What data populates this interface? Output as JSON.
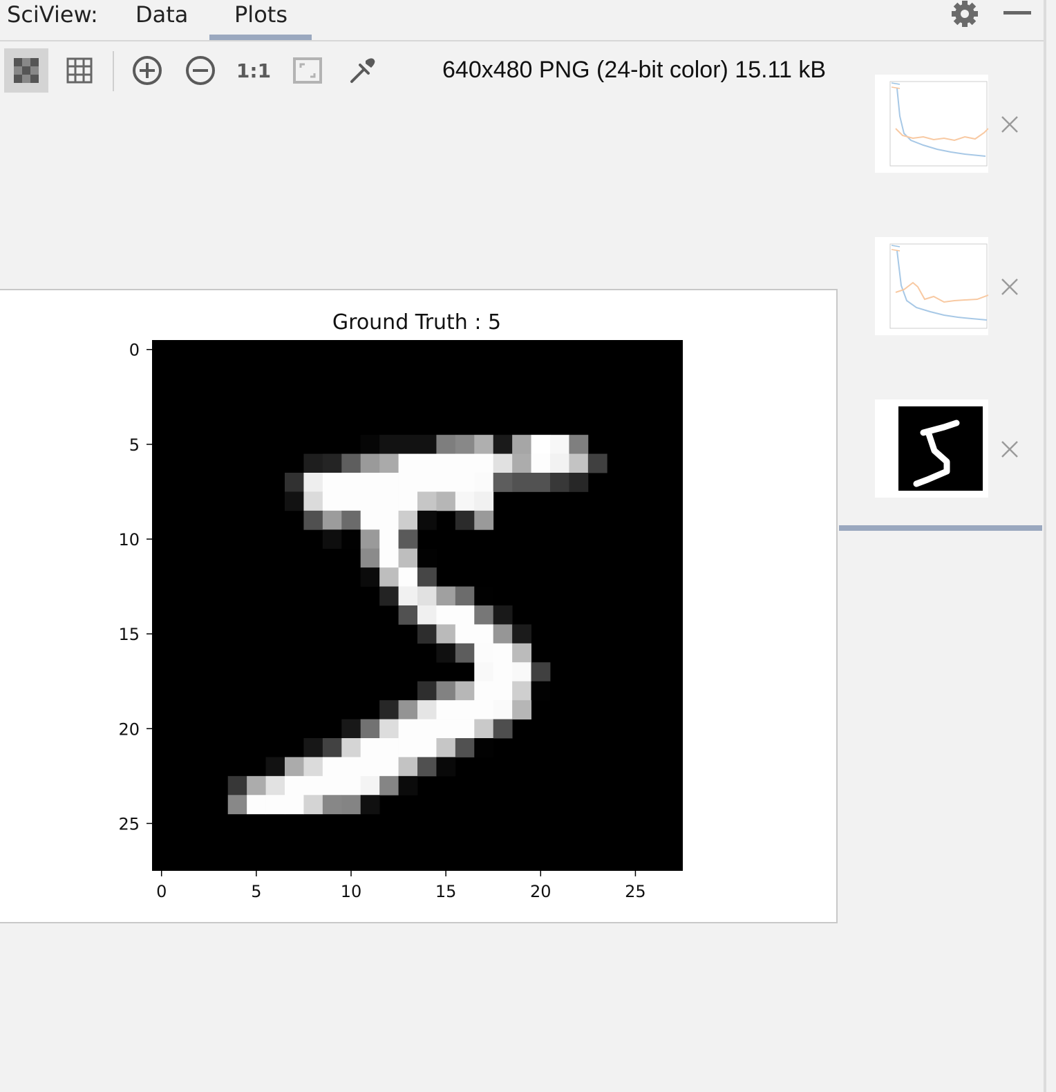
{
  "header": {
    "app_label": "SciView:",
    "tabs": [
      {
        "label": "Data",
        "active": false
      },
      {
        "label": "Plots",
        "active": true
      }
    ],
    "settings_icon": "gear-icon",
    "minimize_icon": "minimize-icon"
  },
  "toolbar": {
    "buttons": [
      {
        "name": "chessboard-toggle",
        "icon": "chessboard-icon",
        "active": true
      },
      {
        "name": "grid-toggle",
        "icon": "grid-icon",
        "active": false
      },
      {
        "name": "zoom-in",
        "icon": "zoom-in-icon",
        "active": false
      },
      {
        "name": "zoom-out",
        "icon": "zoom-out-icon",
        "active": false
      },
      {
        "name": "actual-size",
        "icon": "one-to-one-icon",
        "label": "1:1",
        "active": false
      },
      {
        "name": "fit-zoom",
        "icon": "fit-zoom-icon",
        "active": false
      },
      {
        "name": "color-picker",
        "icon": "eyedropper-icon",
        "active": false
      }
    ],
    "image_info": "640x480 PNG (24-bit color) 15.11 kB"
  },
  "plot": {
    "title": "Ground Truth : 5",
    "x_ticks": [
      "0",
      "5",
      "10",
      "15",
      "20",
      "25"
    ],
    "y_ticks": [
      "0",
      "5",
      "10",
      "15",
      "20",
      "25"
    ]
  },
  "chart_data": {
    "type": "heatmap",
    "title": "Ground Truth : 5",
    "xlim": [
      -0.5,
      27.5
    ],
    "ylim": [
      27.5,
      -0.5
    ],
    "colormap": "gray",
    "grid": false,
    "rows": 28,
    "cols": 28,
    "pixels": [
      [
        5,
        11,
        6
      ],
      [
        5,
        12,
        18
      ],
      [
        5,
        13,
        18
      ],
      [
        5,
        14,
        18
      ],
      [
        5,
        15,
        126
      ],
      [
        5,
        16,
        136
      ],
      [
        5,
        17,
        175
      ],
      [
        5,
        18,
        26
      ],
      [
        5,
        19,
        166
      ],
      [
        5,
        20,
        255
      ],
      [
        5,
        21,
        247
      ],
      [
        5,
        22,
        127
      ],
      [
        6,
        8,
        30
      ],
      [
        6,
        9,
        36
      ],
      [
        6,
        10,
        94
      ],
      [
        6,
        11,
        154
      ],
      [
        6,
        12,
        170
      ],
      [
        6,
        13,
        253
      ],
      [
        6,
        14,
        253
      ],
      [
        6,
        15,
        253
      ],
      [
        6,
        16,
        253
      ],
      [
        6,
        17,
        253
      ],
      [
        6,
        18,
        225
      ],
      [
        6,
        19,
        172
      ],
      [
        6,
        20,
        253
      ],
      [
        6,
        21,
        242
      ],
      [
        6,
        22,
        195
      ],
      [
        6,
        23,
        64
      ],
      [
        7,
        7,
        49
      ],
      [
        7,
        8,
        238
      ],
      [
        7,
        9,
        253
      ],
      [
        7,
        10,
        253
      ],
      [
        7,
        11,
        253
      ],
      [
        7,
        12,
        253
      ],
      [
        7,
        13,
        253
      ],
      [
        7,
        14,
        253
      ],
      [
        7,
        15,
        253
      ],
      [
        7,
        16,
        253
      ],
      [
        7,
        17,
        251
      ],
      [
        7,
        18,
        93
      ],
      [
        7,
        19,
        82
      ],
      [
        7,
        20,
        82
      ],
      [
        7,
        21,
        56
      ],
      [
        7,
        22,
        39
      ],
      [
        8,
        7,
        18
      ],
      [
        8,
        8,
        219
      ],
      [
        8,
        9,
        253
      ],
      [
        8,
        10,
        253
      ],
      [
        8,
        11,
        253
      ],
      [
        8,
        12,
        253
      ],
      [
        8,
        13,
        253
      ],
      [
        8,
        14,
        198
      ],
      [
        8,
        15,
        182
      ],
      [
        8,
        16,
        247
      ],
      [
        8,
        17,
        241
      ],
      [
        9,
        8,
        80
      ],
      [
        9,
        9,
        156
      ],
      [
        9,
        10,
        107
      ],
      [
        9,
        11,
        253
      ],
      [
        9,
        12,
        253
      ],
      [
        9,
        13,
        205
      ],
      [
        9,
        14,
        11
      ],
      [
        9,
        16,
        43
      ],
      [
        9,
        17,
        154
      ],
      [
        10,
        9,
        14
      ],
      [
        10,
        10,
        1
      ],
      [
        10,
        11,
        154
      ],
      [
        10,
        12,
        253
      ],
      [
        10,
        13,
        90
      ],
      [
        11,
        11,
        139
      ],
      [
        11,
        12,
        253
      ],
      [
        11,
        13,
        190
      ],
      [
        11,
        14,
        2
      ],
      [
        12,
        11,
        11
      ],
      [
        12,
        12,
        190
      ],
      [
        12,
        13,
        253
      ],
      [
        12,
        14,
        70
      ],
      [
        13,
        12,
        35
      ],
      [
        13,
        13,
        241
      ],
      [
        13,
        14,
        225
      ],
      [
        13,
        15,
        160
      ],
      [
        13,
        16,
        108
      ],
      [
        13,
        17,
        1
      ],
      [
        14,
        13,
        81
      ],
      [
        14,
        14,
        240
      ],
      [
        14,
        15,
        253
      ],
      [
        14,
        16,
        253
      ],
      [
        14,
        17,
        119
      ],
      [
        14,
        18,
        25
      ],
      [
        15,
        14,
        45
      ],
      [
        15,
        15,
        186
      ],
      [
        15,
        16,
        253
      ],
      [
        15,
        17,
        253
      ],
      [
        15,
        18,
        150
      ],
      [
        15,
        19,
        27
      ],
      [
        16,
        15,
        16
      ],
      [
        16,
        16,
        93
      ],
      [
        16,
        17,
        252
      ],
      [
        16,
        18,
        253
      ],
      [
        16,
        19,
        187
      ],
      [
        17,
        17,
        249
      ],
      [
        17,
        18,
        253
      ],
      [
        17,
        19,
        249
      ],
      [
        17,
        20,
        64
      ],
      [
        18,
        14,
        46
      ],
      [
        18,
        15,
        130
      ],
      [
        18,
        16,
        183
      ],
      [
        18,
        17,
        253
      ],
      [
        18,
        18,
        253
      ],
      [
        18,
        19,
        207
      ],
      [
        18,
        20,
        2
      ],
      [
        19,
        12,
        39
      ],
      [
        19,
        13,
        148
      ],
      [
        19,
        14,
        229
      ],
      [
        19,
        15,
        253
      ],
      [
        19,
        16,
        253
      ],
      [
        19,
        17,
        253
      ],
      [
        19,
        18,
        250
      ],
      [
        19,
        19,
        182
      ],
      [
        20,
        10,
        24
      ],
      [
        20,
        11,
        114
      ],
      [
        20,
        12,
        221
      ],
      [
        20,
        13,
        253
      ],
      [
        20,
        14,
        253
      ],
      [
        20,
        15,
        253
      ],
      [
        20,
        16,
        253
      ],
      [
        20,
        17,
        201
      ],
      [
        20,
        18,
        78
      ],
      [
        21,
        8,
        23
      ],
      [
        21,
        9,
        66
      ],
      [
        21,
        10,
        213
      ],
      [
        21,
        11,
        253
      ],
      [
        21,
        12,
        253
      ],
      [
        21,
        13,
        253
      ],
      [
        21,
        14,
        253
      ],
      [
        21,
        15,
        198
      ],
      [
        21,
        16,
        81
      ],
      [
        21,
        17,
        2
      ],
      [
        22,
        6,
        18
      ],
      [
        22,
        7,
        171
      ],
      [
        22,
        8,
        219
      ],
      [
        22,
        9,
        253
      ],
      [
        22,
        10,
        253
      ],
      [
        22,
        11,
        253
      ],
      [
        22,
        12,
        253
      ],
      [
        22,
        13,
        195
      ],
      [
        22,
        14,
        80
      ],
      [
        22,
        15,
        9
      ],
      [
        23,
        4,
        55
      ],
      [
        23,
        5,
        172
      ],
      [
        23,
        6,
        226
      ],
      [
        23,
        7,
        253
      ],
      [
        23,
        8,
        253
      ],
      [
        23,
        9,
        253
      ],
      [
        23,
        10,
        253
      ],
      [
        23,
        11,
        244
      ],
      [
        23,
        12,
        133
      ],
      [
        23,
        13,
        11
      ],
      [
        24,
        4,
        136
      ],
      [
        24,
        5,
        253
      ],
      [
        24,
        6,
        253
      ],
      [
        24,
        7,
        253
      ],
      [
        24,
        8,
        212
      ],
      [
        24,
        9,
        135
      ],
      [
        24,
        10,
        132
      ],
      [
        24,
        11,
        16
      ]
    ]
  },
  "thumbnails": [
    {
      "name": "thumbnail-loss-plot-1",
      "kind": "line-plot",
      "close_icon": "close-icon"
    },
    {
      "name": "thumbnail-loss-plot-2",
      "kind": "line-plot",
      "close_icon": "close-icon"
    },
    {
      "name": "thumbnail-digit-image",
      "kind": "digit-image",
      "selected": true,
      "close_icon": "close-icon"
    }
  ]
}
